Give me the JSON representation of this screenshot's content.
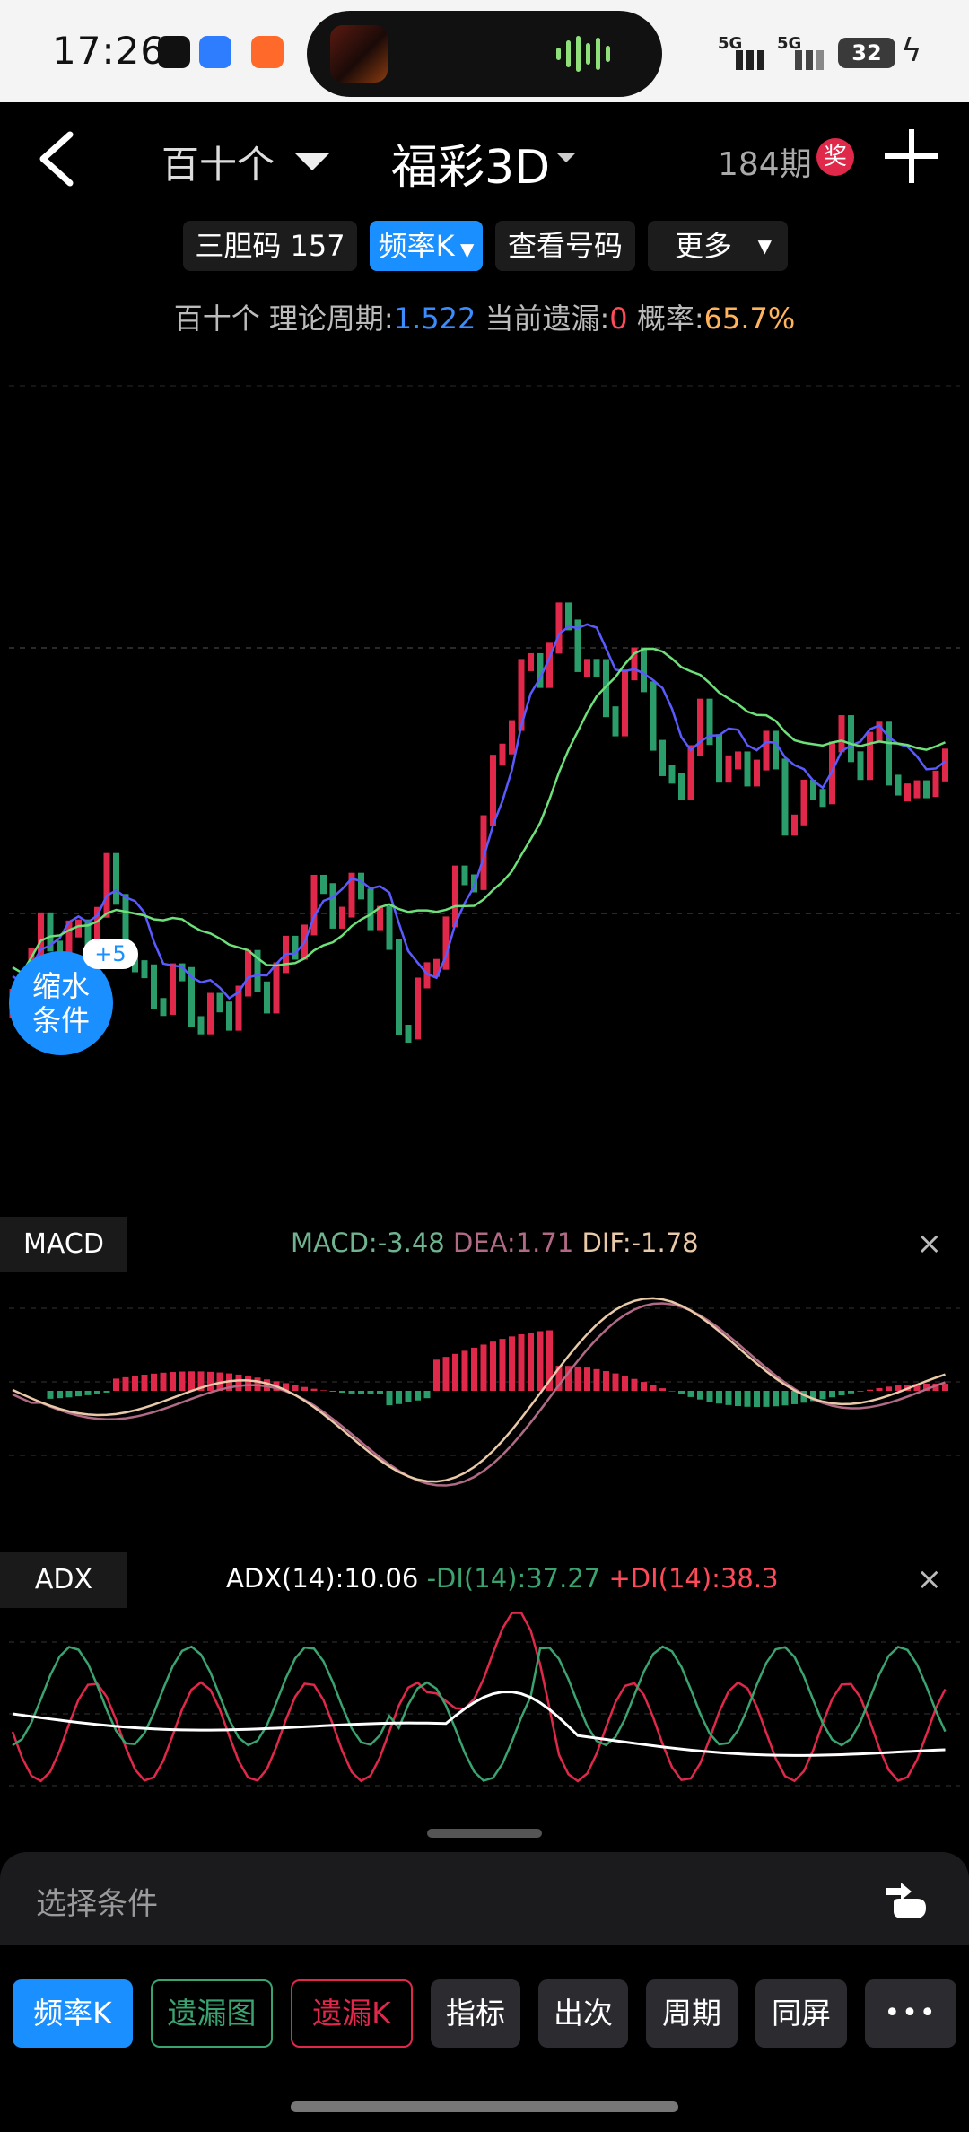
{
  "status": {
    "time": "17:26",
    "signal1": "5G",
    "signal2": "5G",
    "battery": "32"
  },
  "header": {
    "position_selector": "百十个",
    "title": "福彩3D",
    "period": "184期",
    "prize_badge": "奖"
  },
  "chips": [
    {
      "label": "三胆码 157",
      "active": false
    },
    {
      "label": "频率K",
      "active": true
    },
    {
      "label": "查看号码",
      "active": false
    },
    {
      "label": "更多",
      "active": false
    }
  ],
  "stats": {
    "prefix": "百十个 理论周期:",
    "theory_cycle": "1.522",
    "miss_label": "当前遗漏:",
    "current_miss": "0",
    "prob_label": "概率:",
    "probability": "65.7%"
  },
  "shrink": {
    "line1": "缩水",
    "line2": "条件",
    "badge": "+5"
  },
  "macd": {
    "tag": "MACD",
    "macd_label": "MACD:-3.48",
    "dea_label": "DEA:1.71",
    "dif_label": "DIF:-1.78",
    "close": "×"
  },
  "adx": {
    "tag": "ADX",
    "adx_label": "ADX(14):10.06",
    "mdi_label": "-DI(14):37.27",
    "pdi_label": "+DI(14):38.3",
    "close": "×"
  },
  "condition": {
    "label": "选择条件"
  },
  "tabs": [
    {
      "label": "频率K",
      "style": "active"
    },
    {
      "label": "遗漏图",
      "style": "outline-green"
    },
    {
      "label": "遗漏K",
      "style": "outline-red"
    },
    {
      "label": "指标",
      "style": "normal"
    },
    {
      "label": "出次",
      "style": "normal"
    },
    {
      "label": "周期",
      "style": "normal"
    },
    {
      "label": "同屏",
      "style": "normal"
    },
    {
      "label": "•••",
      "style": "normal"
    }
  ],
  "colors": {
    "accent": "#1a8fff",
    "up": "#e0284a",
    "down": "#2a9d6a",
    "ma_fast": "#5a5aff",
    "ma_slow": "#6ee07a",
    "dif": "#e8c9a8",
    "dea": "#b06a86"
  }
}
